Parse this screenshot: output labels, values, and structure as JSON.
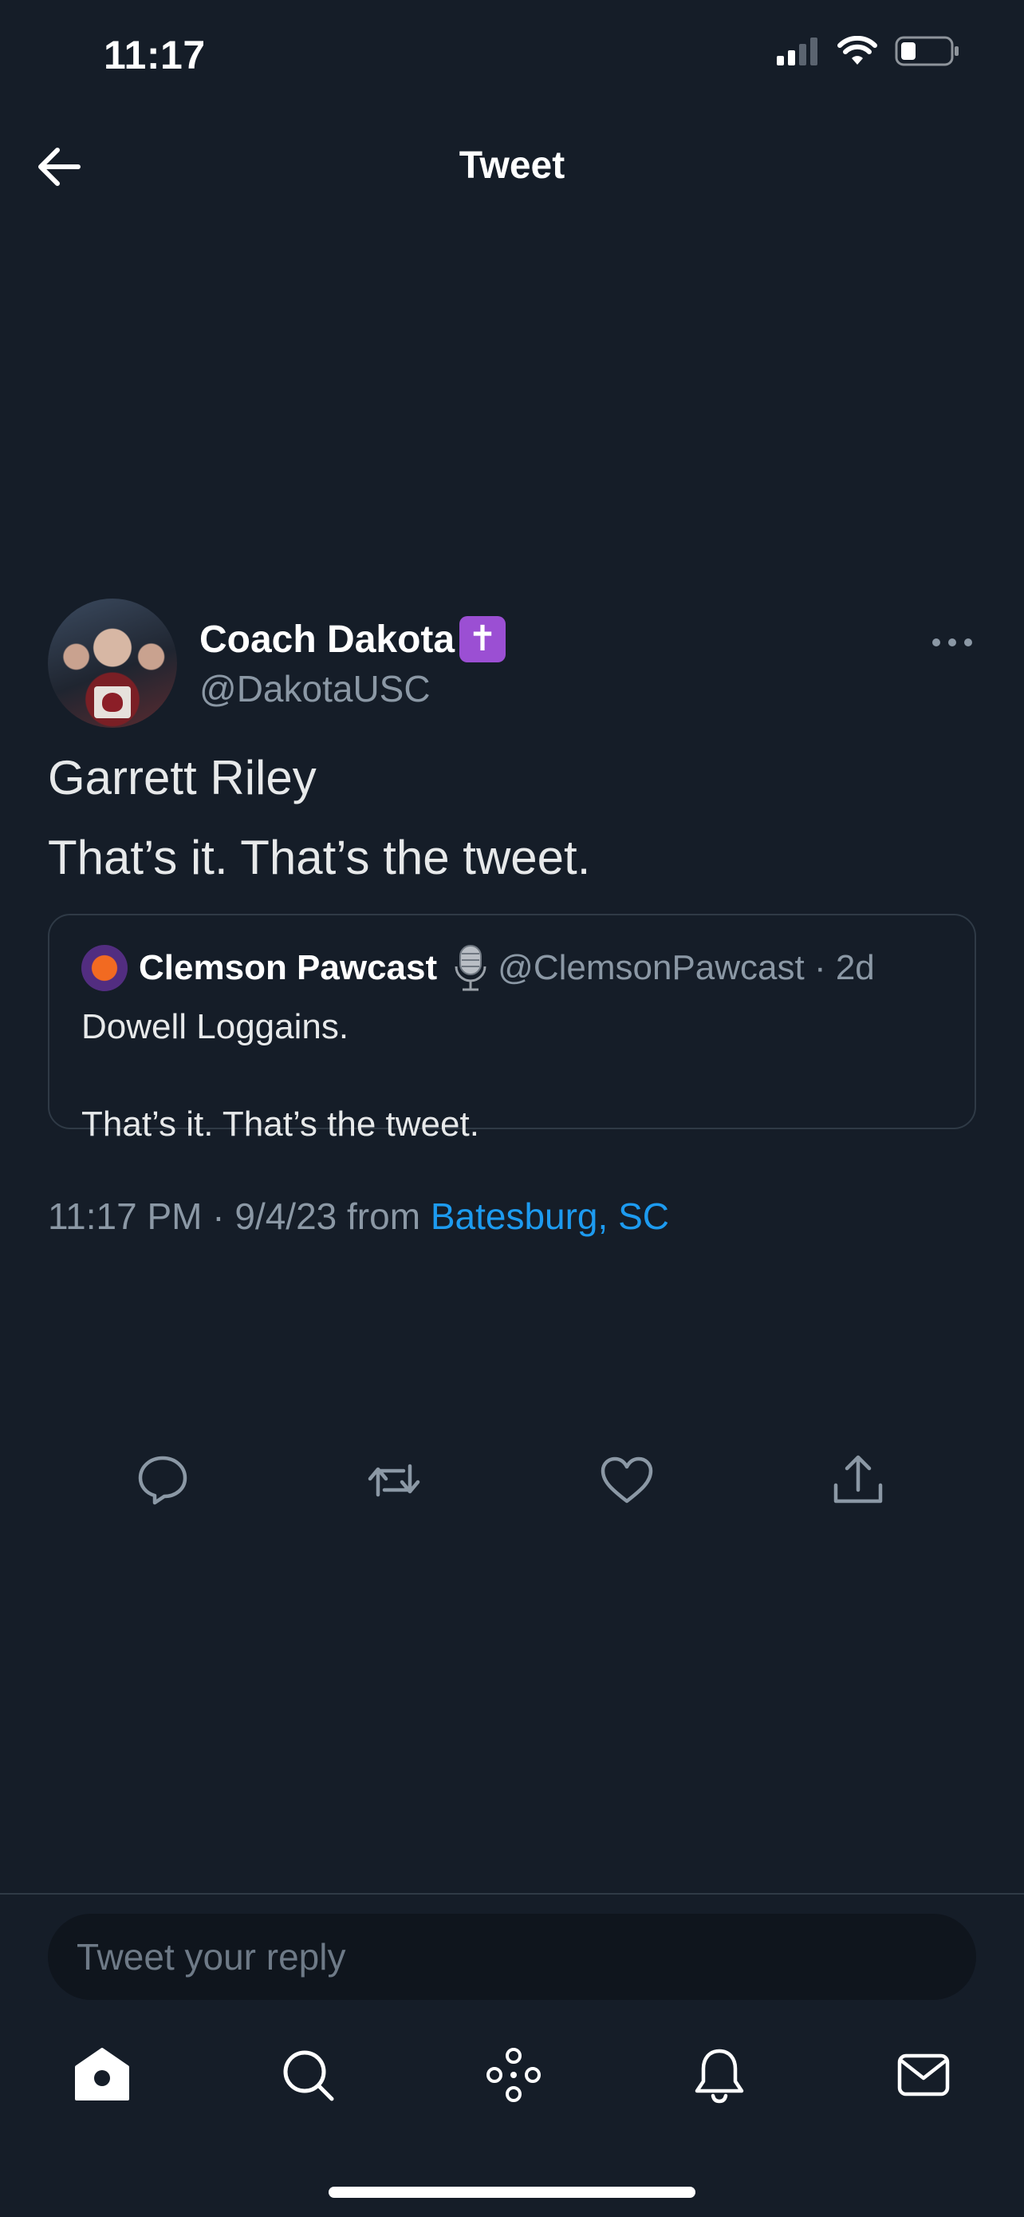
{
  "status_bar": {
    "time": "11:17",
    "icons": [
      "cellular-signal-icon",
      "wifi-icon",
      "battery-icon"
    ]
  },
  "header": {
    "title": "Tweet",
    "back_icon": "back-arrow-icon"
  },
  "tweet": {
    "author": {
      "display_name": "Coach Dakota",
      "badge": "✝",
      "handle": "@DakotaUSC"
    },
    "text_lines": [
      "Garrett Riley",
      "That’s it. That’s the tweet."
    ],
    "quote": {
      "display_name": "Clemson Pawcast",
      "handle_and_time": "@ClemsonPawcast · 2d",
      "emoji_icon": "microphone-icon",
      "text_lines": [
        "Dowell Loggains.",
        "That’s it. That’s the tweet."
      ]
    },
    "meta": {
      "timestamp": "11:17 PM · 9/4/23 from ",
      "location": "Batesburg, SC"
    }
  },
  "actions": [
    "reply-icon",
    "retweet-icon",
    "like-icon",
    "share-icon"
  ],
  "composer": {
    "placeholder": "Tweet your reply"
  },
  "tab_bar": [
    "home-icon",
    "search-icon",
    "spaces-icon",
    "notifications-icon",
    "messages-icon"
  ],
  "colors": {
    "background": "#151d28",
    "accent": "#1d9bf0",
    "secondary_text": "#8b98a5",
    "badge": "#9b4fd3"
  }
}
